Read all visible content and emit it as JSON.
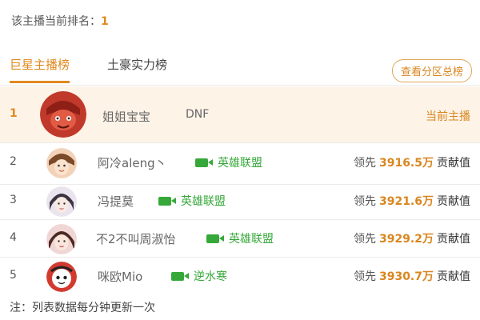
{
  "header": {
    "rank_label": "该主播当前排名：",
    "rank_value": "1"
  },
  "tabs": [
    {
      "label": "巨星主播榜",
      "active": true
    },
    {
      "label": "土豪实力榜",
      "active": false
    }
  ],
  "zone_button": "查看分区总榜",
  "first_row": {
    "rank": "1",
    "name": "姐姐宝宝",
    "game": "DNF",
    "tag": "当前主播"
  },
  "rows": [
    {
      "rank": "2",
      "name": "阿冷aleng丶",
      "game": "英雄联盟",
      "lead_label": "领先",
      "amount": "3916.5万",
      "contrib": "贡献值"
    },
    {
      "rank": "3",
      "name": "冯提莫",
      "game": "英雄联盟",
      "lead_label": "领先",
      "amount": "3921.6万",
      "contrib": "贡献值"
    },
    {
      "rank": "4",
      "name": "不2不叫周淑怡",
      "game": "英雄联盟",
      "lead_label": "领先",
      "amount": "3929.2万",
      "contrib": "贡献值"
    },
    {
      "rank": "5",
      "name": "咪欧Mio",
      "game": "逆水寒",
      "lead_label": "领先",
      "amount": "3930.7万",
      "contrib": "贡献值"
    }
  ],
  "note": "注：列表数据每分钟更新一次",
  "colors": {
    "accent": "#e08a1e",
    "game_green": "#36a83a",
    "highlight_row": "#fdf3e7"
  }
}
